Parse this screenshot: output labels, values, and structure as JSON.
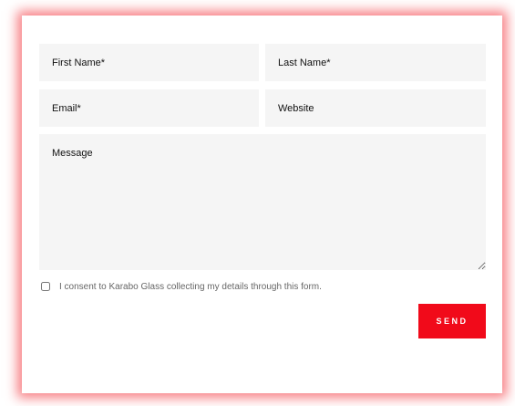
{
  "form": {
    "first_name": {
      "placeholder": "First Name*",
      "value": ""
    },
    "last_name": {
      "placeholder": "Last Name*",
      "value": ""
    },
    "email": {
      "placeholder": "Email*",
      "value": ""
    },
    "website": {
      "placeholder": "Website",
      "value": ""
    },
    "message": {
      "placeholder": "Message",
      "value": ""
    },
    "consent": {
      "label": "I consent to Karabo Glass collecting my details through this form.",
      "checked": false
    },
    "send_label": "SEND"
  },
  "colors": {
    "accent": "#f10a1a",
    "field_background": "#f5f5f5",
    "card_glow": "#f0141e"
  }
}
